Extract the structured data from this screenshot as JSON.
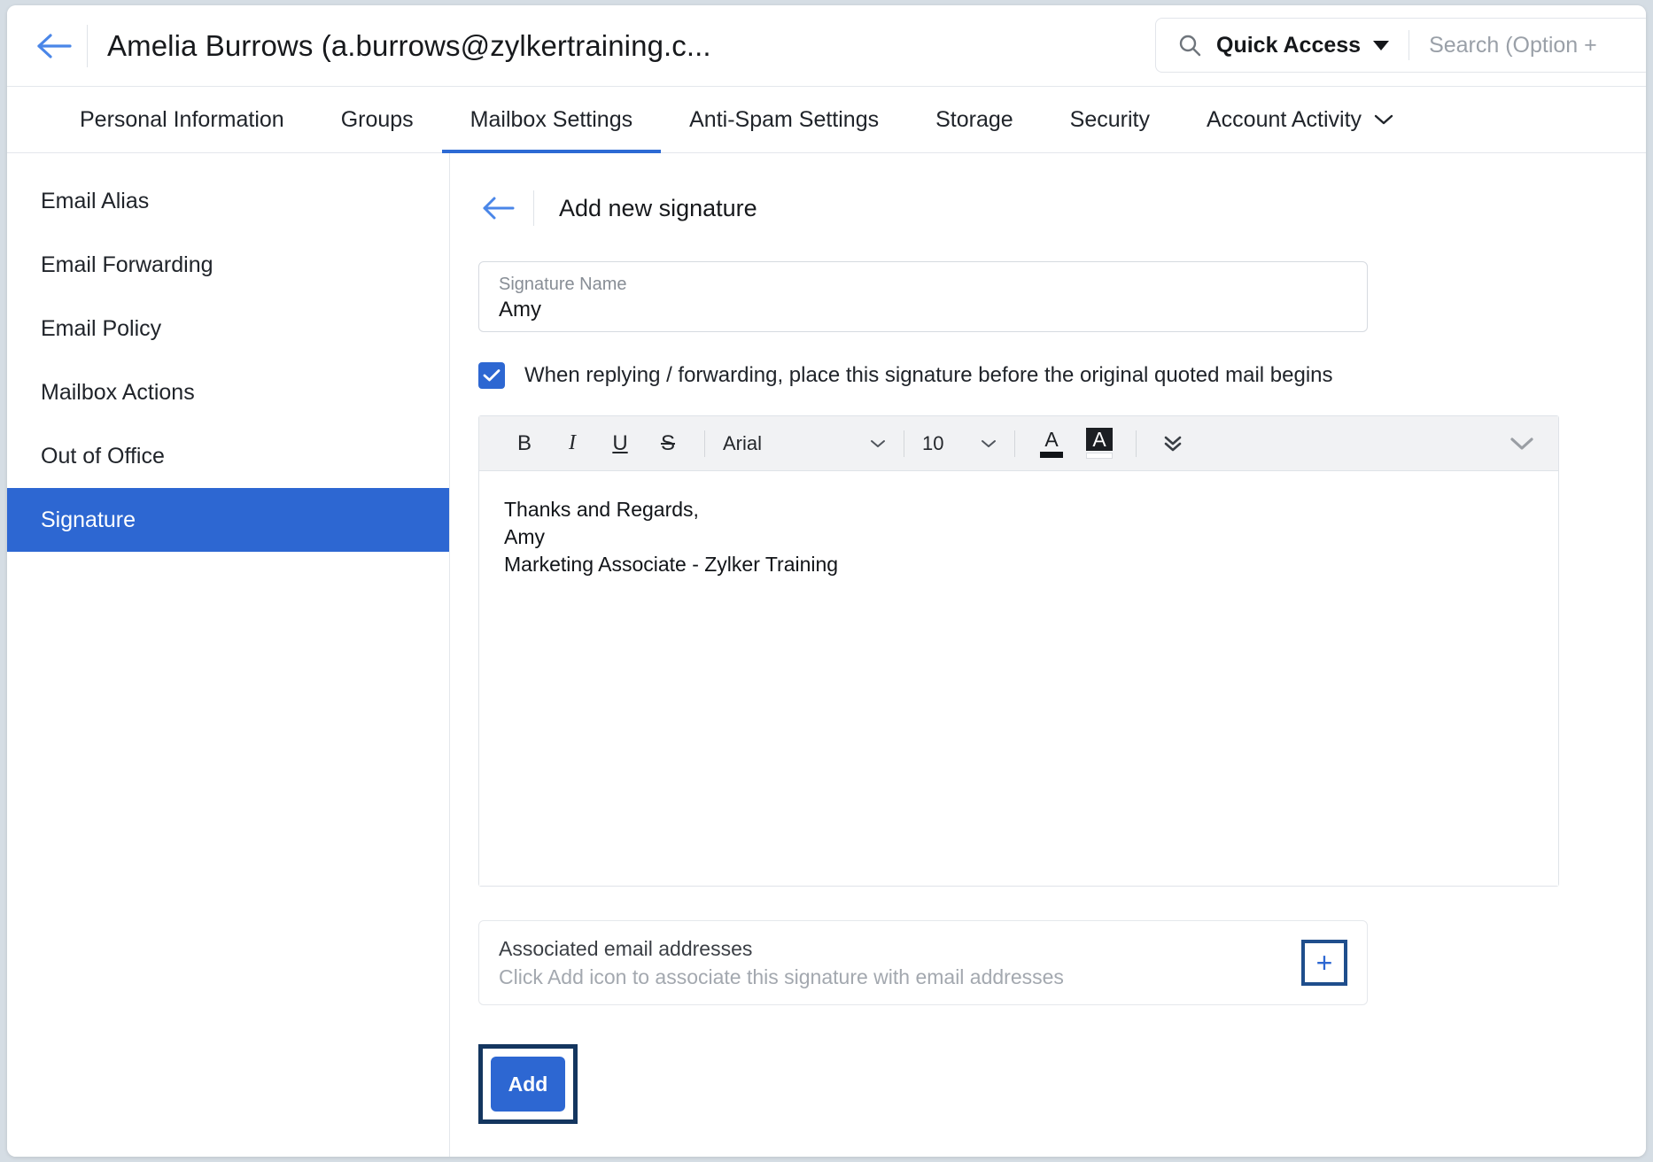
{
  "topbar": {
    "back_icon": "back-arrow-icon",
    "user_title": "Amelia Burrows (a.burrows@zylkertraining.c...",
    "search": {
      "icon": "search-icon",
      "quick_access_label": "Quick Access",
      "caret_icon": "caret-down-icon",
      "placeholder": "Search (Option +"
    }
  },
  "tabs": [
    {
      "label": "Personal Information",
      "active": false
    },
    {
      "label": "Groups",
      "active": false
    },
    {
      "label": "Mailbox Settings",
      "active": true
    },
    {
      "label": "Anti-Spam Settings",
      "active": false
    },
    {
      "label": "Storage",
      "active": false
    },
    {
      "label": "Security",
      "active": false
    },
    {
      "label": "Account Activity",
      "active": false,
      "has_chevron": true
    }
  ],
  "sidebar": {
    "items": [
      {
        "label": "Email Alias",
        "active": false
      },
      {
        "label": "Email Forwarding",
        "active": false
      },
      {
        "label": "Email Policy",
        "active": false
      },
      {
        "label": "Mailbox Actions",
        "active": false
      },
      {
        "label": "Out of Office",
        "active": false
      },
      {
        "label": "Signature",
        "active": true
      }
    ]
  },
  "main": {
    "back_icon": "back-arrow-icon",
    "heading": "Add new signature",
    "signature_name": {
      "label": "Signature Name",
      "value": "Amy"
    },
    "checkbox": {
      "checked": true,
      "label": "When replying / forwarding, place this signature before the original quoted mail begins"
    },
    "editor": {
      "toolbar": {
        "bold": "B",
        "italic": "I",
        "underline": "U",
        "strikethrough": "S",
        "font_family": "Arial",
        "font_size": "10",
        "text_color_glyph": "A",
        "highlight_glyph": "A",
        "more_icon": "double-chevron-down-icon",
        "expand_icon": "chevron-down-icon"
      },
      "content_lines": [
        "Thanks and Regards,",
        "Amy",
        "Marketing Associate - Zylker Training"
      ]
    },
    "associated": {
      "title": "Associated email addresses",
      "subtitle": "Click Add icon to associate this signature with email addresses",
      "add_icon": "plus-icon"
    },
    "add_button": "Add"
  },
  "colors": {
    "accent_blue": "#2d67d2",
    "highlight_navy": "#14365f",
    "page_bg": "#d5dde4"
  }
}
